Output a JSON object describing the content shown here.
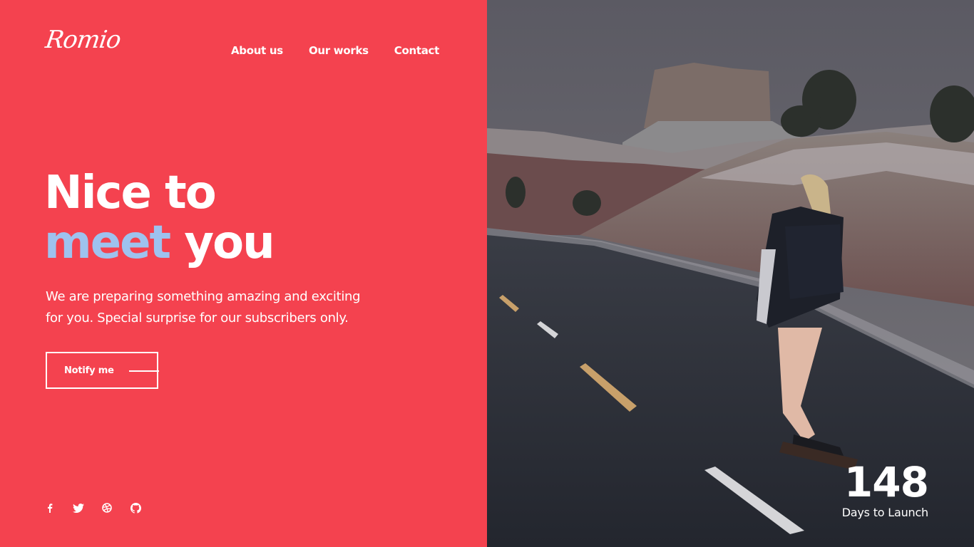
{
  "brand": {
    "logo_text": "Romio"
  },
  "nav": {
    "items": [
      {
        "label": "About us"
      },
      {
        "label": "Our works"
      },
      {
        "label": "Contact"
      }
    ]
  },
  "hero": {
    "line1": "Nice to",
    "accent_word": "meet",
    "line2_rest": " you",
    "description": "We are preparing something amazing and exciting for you. Special surprise for our subscribers only.",
    "cta_label": "Notify me"
  },
  "social": {
    "icons": [
      "facebook-icon",
      "twitter-icon",
      "dribbble-icon",
      "github-icon"
    ]
  },
  "countdown": {
    "days": "148",
    "label": "Days to Launch"
  },
  "colors": {
    "primary": "#f4424f",
    "accent": "#9ec2ee",
    "text": "#ffffff"
  }
}
